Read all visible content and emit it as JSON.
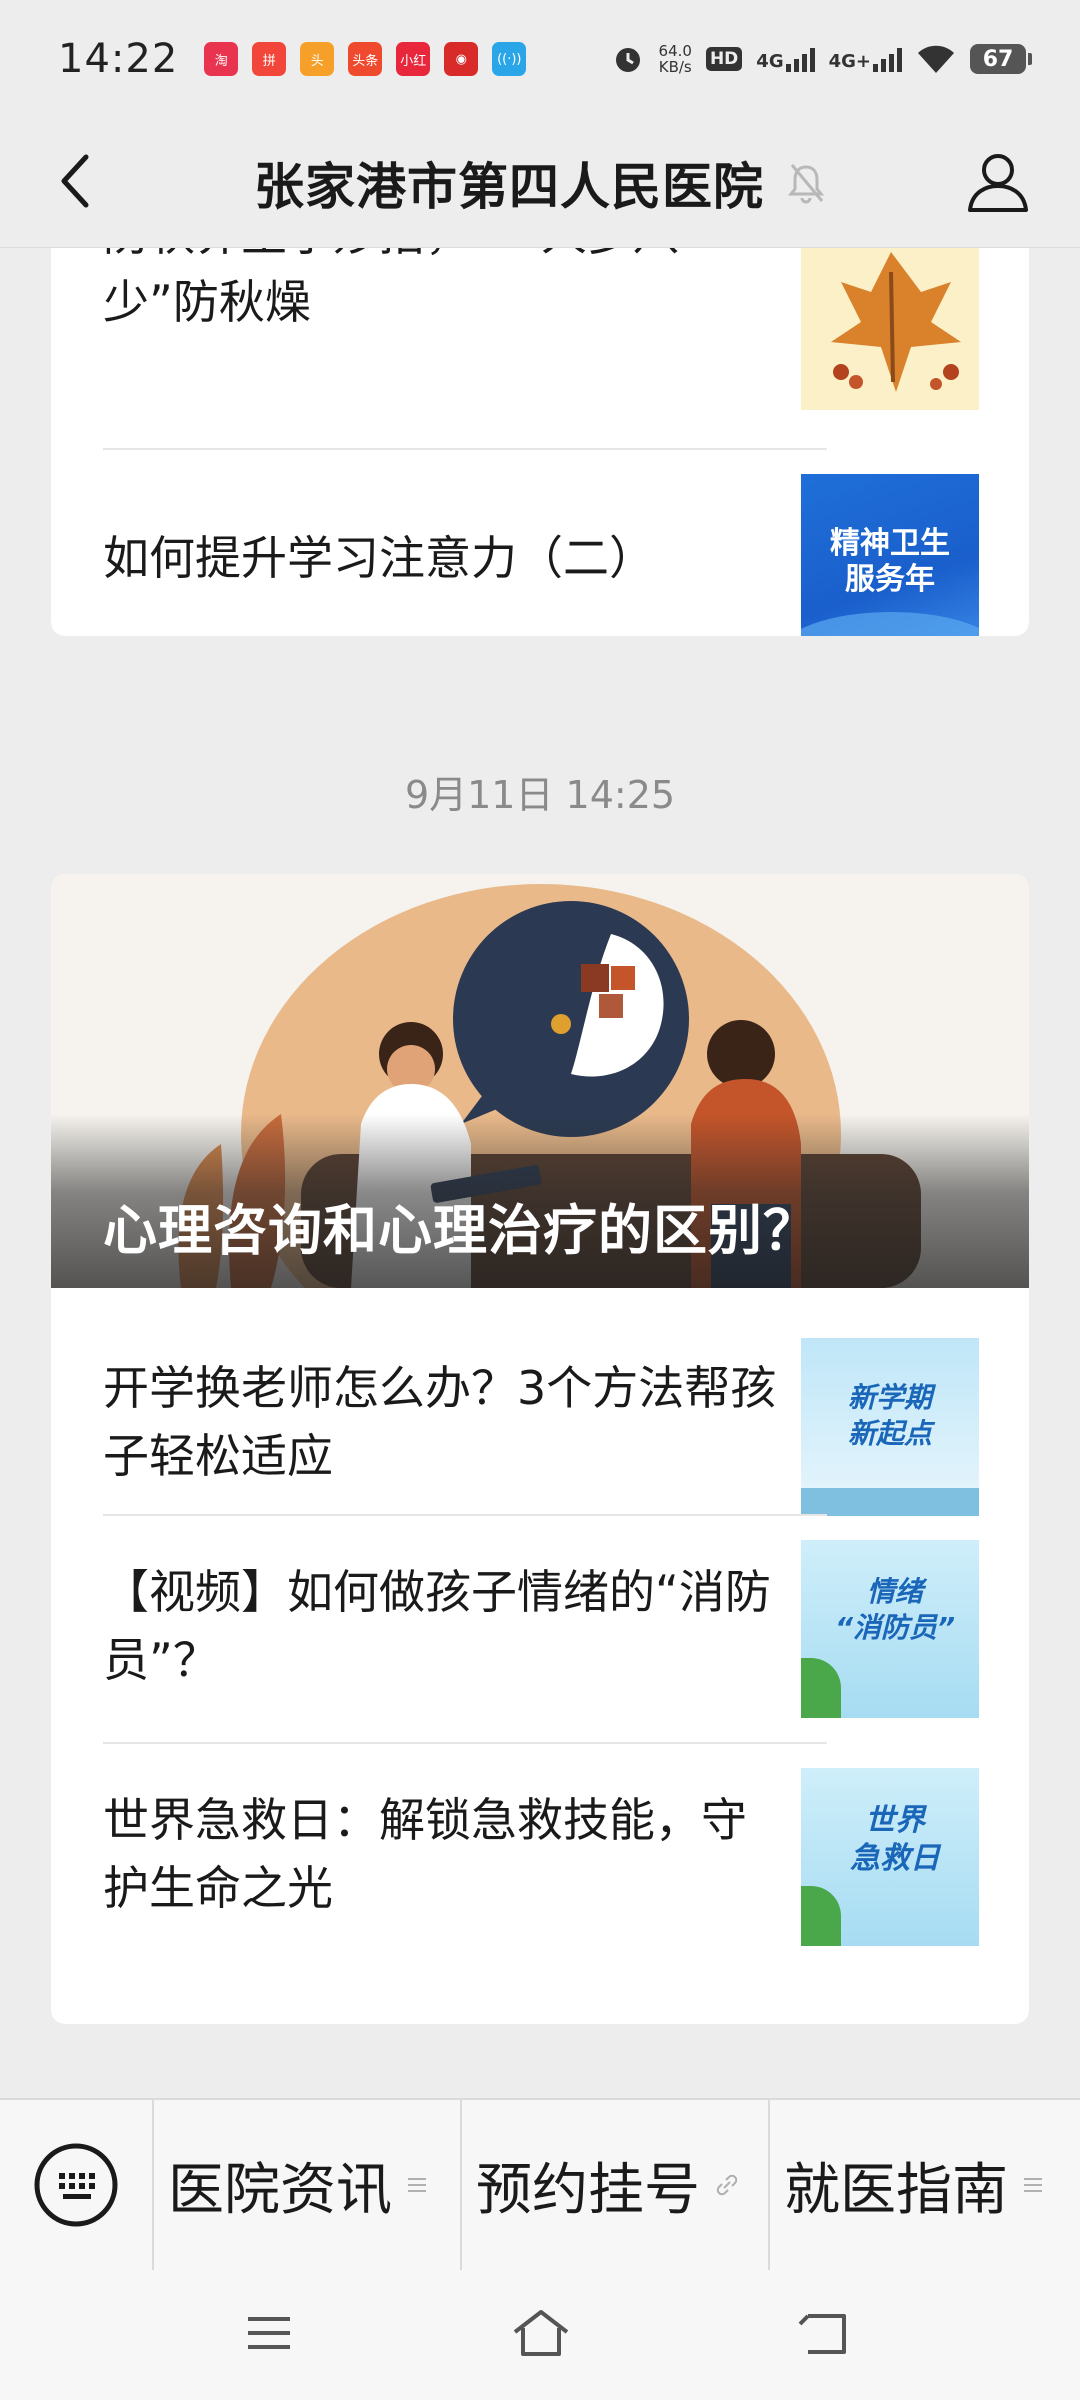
{
  "status_bar": {
    "time": "14:22",
    "network_speed_value": "64.0",
    "network_speed_unit": "KB/s",
    "hd_label": "HD",
    "sim1_label": "4G",
    "sim2_label": "4G+",
    "battery_level": "67",
    "notification_icons": [
      {
        "name": "app-notification-icon-1",
        "color": "#e8344e",
        "glyph": "淘"
      },
      {
        "name": "app-notification-icon-2",
        "color": "#f2463a",
        "glyph": "拼"
      },
      {
        "name": "app-notification-icon-3",
        "color": "#f6a02a",
        "glyph": "头"
      },
      {
        "name": "app-notification-icon-4",
        "color": "#f04a2e",
        "glyph": "头条"
      },
      {
        "name": "app-notification-icon-5",
        "color": "#e8273c",
        "glyph": "小红"
      },
      {
        "name": "app-notification-icon-6",
        "color": "#d92a2a",
        "glyph": "◉"
      },
      {
        "name": "app-notification-icon-7",
        "color": "#2aa6e8",
        "glyph": "((·))"
      }
    ]
  },
  "header": {
    "title": "张家港市第四人民医院"
  },
  "feed": {
    "card_a": {
      "articles": [
        {
          "title": "防秋养生小妙招，“一人多八少”防秋燥"
        },
        {
          "title": "如何提升学习注意力（二）",
          "thumb_text_line1": "精神卫生",
          "thumb_text_line2": "服务年"
        }
      ]
    },
    "timestamp": "9月11日 14:25",
    "card_b": {
      "hero_title": "心理咨询和心理治疗的区别？",
      "articles": [
        {
          "title": "开学换老师怎么办？3个方法帮孩子轻松适应",
          "thumb_text_line1": "新学期",
          "thumb_text_line2": "新起点"
        },
        {
          "title": "【视频】如何做孩子情绪的“消防员”？",
          "thumb_text_line1": "情绪",
          "thumb_text_line2": "“消防员”"
        },
        {
          "title": "世界急救日：解锁急救技能，守护生命之光",
          "thumb_text_line1": "世界",
          "thumb_text_line2": "急救日"
        }
      ]
    }
  },
  "bottom_menu": {
    "items": [
      {
        "label": "医院资讯",
        "suffix": "menu"
      },
      {
        "label": "预约挂号",
        "suffix": "link"
      },
      {
        "label": "就医指南",
        "suffix": "menu"
      }
    ]
  },
  "colors": {
    "background": "#ededed",
    "card": "#ffffff",
    "text": "#1a1a1a",
    "timestamp": "#8a8a8a"
  }
}
